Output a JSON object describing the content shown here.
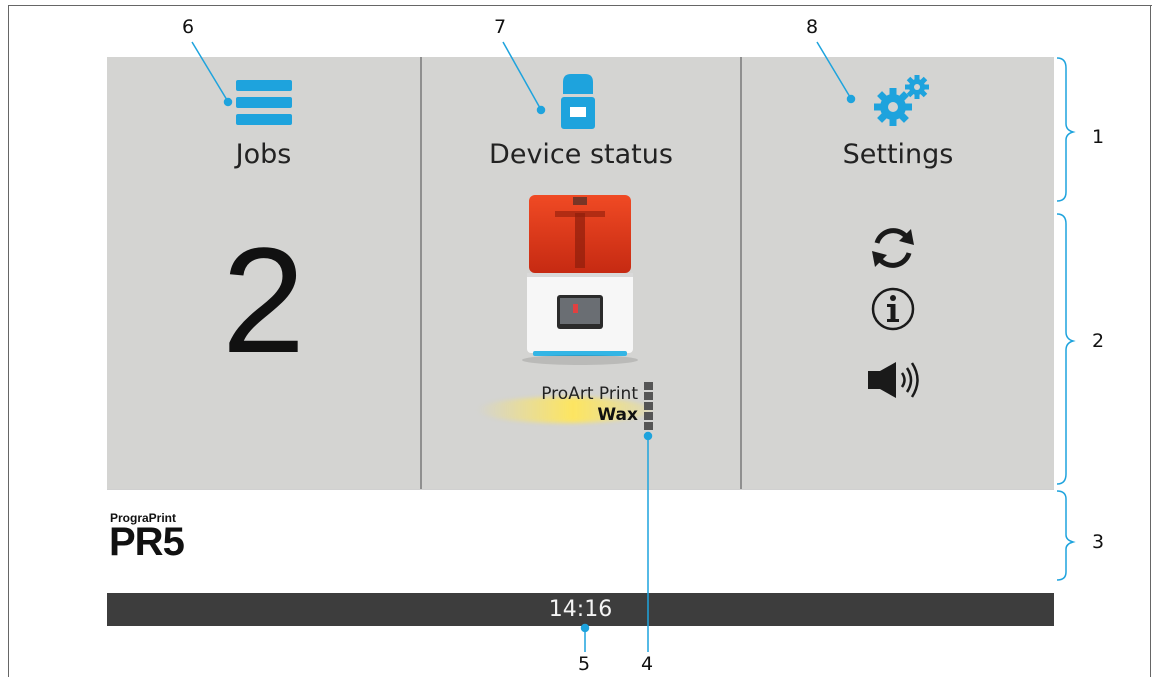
{
  "panels": {
    "jobs": {
      "title": "Jobs",
      "count": "2"
    },
    "device_status": {
      "title": "Device status",
      "material_line1": "ProArt Print",
      "material_line2": "Wax"
    },
    "settings": {
      "title": "Settings"
    }
  },
  "brand": {
    "small": "PrograPrint",
    "big": "PR5"
  },
  "status_bar": {
    "time": "14:16"
  },
  "callouts": [
    "1",
    "2",
    "3",
    "4",
    "5",
    "6",
    "7",
    "8"
  ],
  "icons": {
    "jobs": "list-icon",
    "device_status": "printer-icon",
    "settings": "gears-icon",
    "side_actions": [
      "refresh-icon",
      "info-icon",
      "speaker-icon"
    ]
  },
  "colors": {
    "accent": "#1ea3dd",
    "panel_bg": "#d4d4d2",
    "status_bar": "#3d3d3d"
  }
}
